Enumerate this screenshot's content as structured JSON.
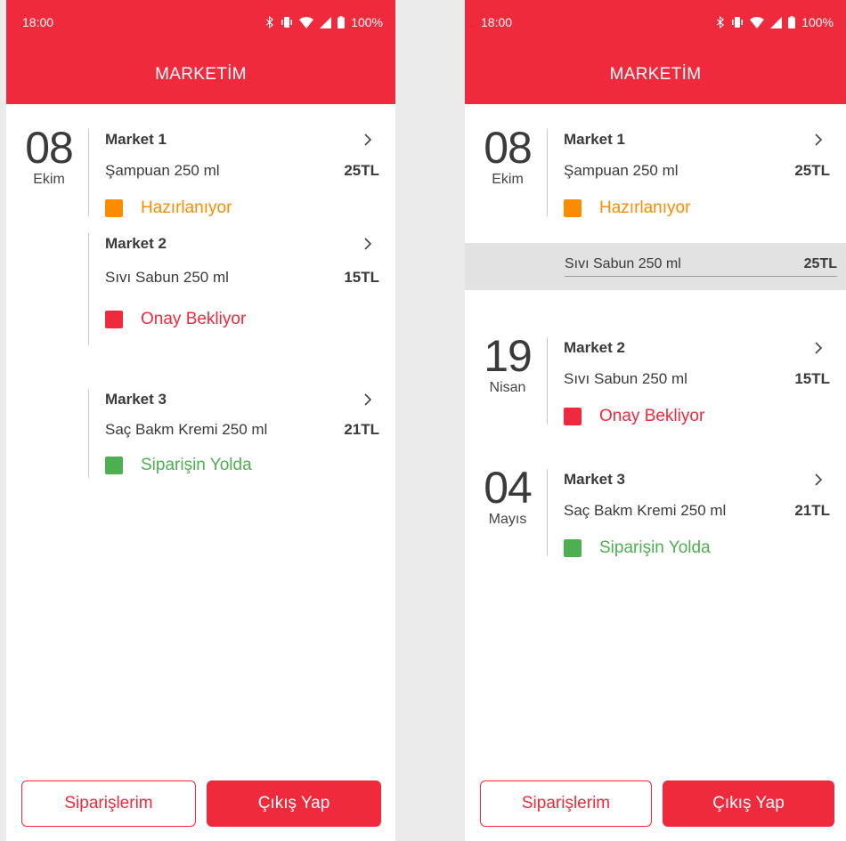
{
  "colors": {
    "accent": "#ef2a3c",
    "pending": "#fb8c00",
    "waiting": "#ef2a3c",
    "shipped": "#4caf50"
  },
  "phone_a": {
    "status_bar": {
      "time": "18:00",
      "battery": "100%"
    },
    "app_title": "MARKETİM",
    "date": {
      "day": "08",
      "month": "Ekim"
    },
    "orders": [
      {
        "market": "Market 1",
        "product": "Şampuan 250 ml",
        "price": "25TL",
        "status": "Hazırlanıyor"
      },
      {
        "market": "Market 2",
        "product": "Sıvı Sabun 250 ml",
        "price": "15TL",
        "status": "Onay Bekliyor"
      },
      {
        "market": "Market 3",
        "product": "Saç Bakm Kremi 250 ml",
        "price": "21TL",
        "status": "Siparişin Yolda"
      }
    ],
    "buttons": {
      "orders": "Siparişlerim",
      "logout": "Çıkış Yap"
    }
  },
  "phone_b": {
    "status_bar": {
      "time": "18:00",
      "battery": "100%"
    },
    "app_title": "MARKETİM",
    "groups": [
      {
        "day": "08",
        "month": "Ekim",
        "market": "Market 1",
        "product": "Şampuan 250 ml",
        "price": "25TL",
        "status": "Hazırlanıyor"
      },
      {
        "day": "19",
        "month": "Nisan",
        "market": "Market 2",
        "product": "Sıvı Sabun 250 ml",
        "price": "15TL",
        "status": "Onay Bekliyor"
      },
      {
        "day": "04",
        "month": "Mayıs",
        "market": "Market 3",
        "product": "Saç Bakm Kremi 250 ml",
        "price": "21TL",
        "status": "Siparişin Yolda"
      }
    ],
    "expanded_item": {
      "product": "Sıvı Sabun 250 ml",
      "price": "25TL"
    },
    "buttons": {
      "orders": "Siparişlerim",
      "logout": "Çıkış Yap"
    }
  }
}
